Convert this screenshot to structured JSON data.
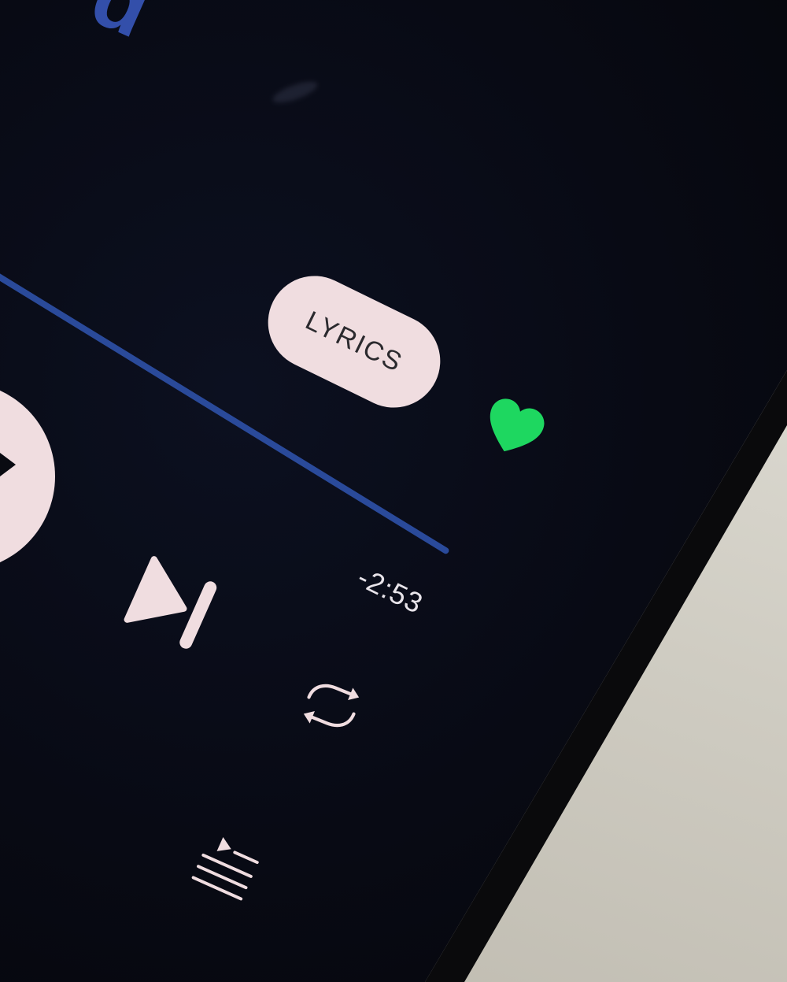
{
  "app": {
    "title_fragment": "d"
  },
  "player": {
    "lyrics_label": "LYRICS",
    "time_remaining": "-2:53",
    "progress_fraction": 0.0,
    "liked": true
  },
  "colors": {
    "screen_bg": "#080a14",
    "progress_bar": "#2a4a9a",
    "button_fill": "#f0dde0",
    "like_green": "#1ed760",
    "text_light": "#e8e4ea",
    "title_blue": "#3b5cc4"
  },
  "icons": {
    "like": "heart-icon",
    "play": "play-icon",
    "next": "skip-next-icon",
    "repeat": "repeat-icon",
    "queue": "queue-icon"
  }
}
